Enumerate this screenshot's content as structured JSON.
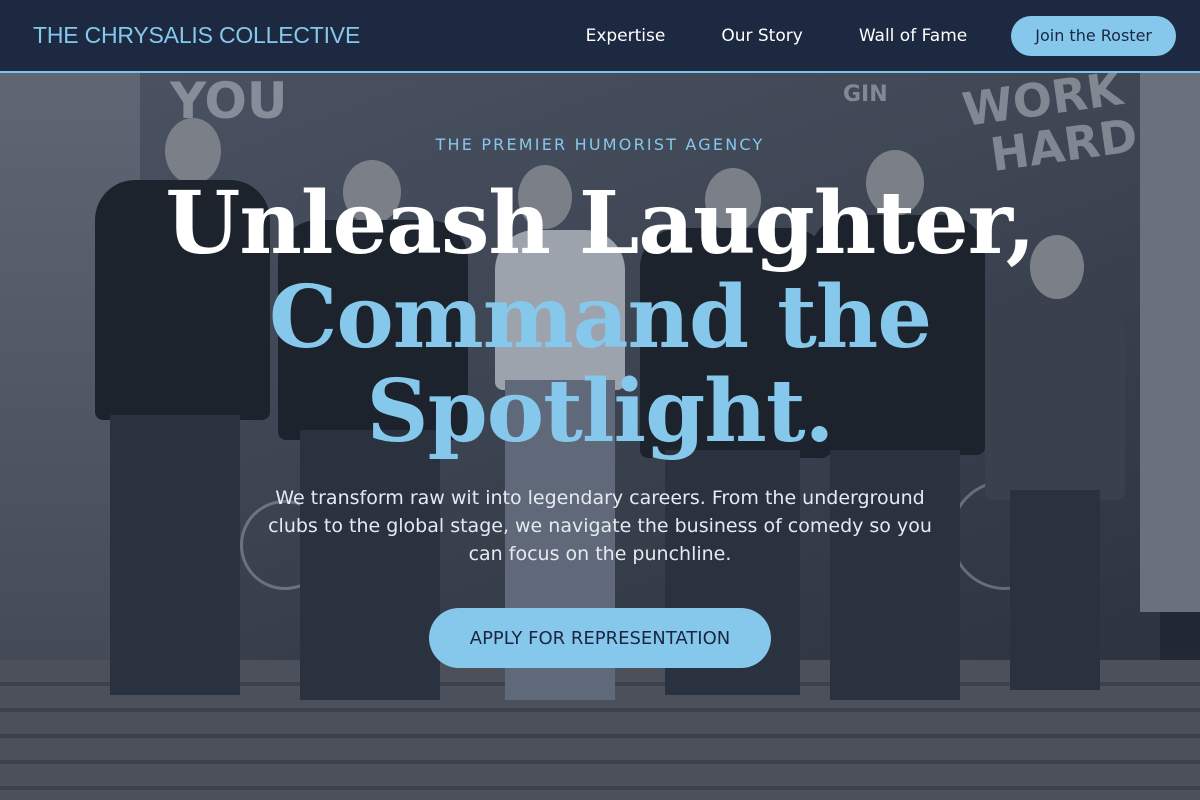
{
  "nav": {
    "brand": "THE CHRYSALIS COLLECTIVE",
    "links": [
      "Expertise",
      "Our Story",
      "Wall of Fame"
    ],
    "cta": "Join the Roster"
  },
  "hero": {
    "eyebrow": "THE PREMIER HUMORIST AGENCY",
    "headline_line1": "Unleash Laughter,",
    "headline_line2": "Command the",
    "headline_line3": "Spotlight.",
    "subtext": "We transform raw wit into legendary careers. From the underground clubs to the global stage, we navigate the business of comedy so you can focus on the punchline.",
    "cta": "APPLY FOR REPRESENTATION",
    "background_image": "team-photo-graffiti-wall",
    "mural_text": [
      "YOU",
      "WORK",
      "HARD",
      "GIN"
    ]
  },
  "colors": {
    "accent": "#86c8ec",
    "nav_bg": "#1d2940",
    "cta_text": "#1b2740"
  }
}
